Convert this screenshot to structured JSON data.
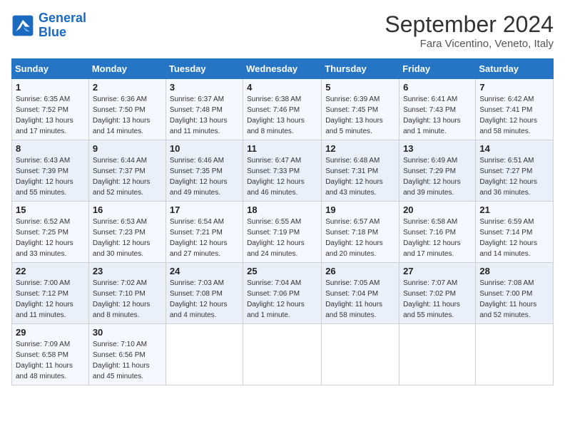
{
  "header": {
    "logo_line1": "General",
    "logo_line2": "Blue",
    "month_title": "September 2024",
    "location": "Fara Vicentino, Veneto, Italy"
  },
  "columns": [
    "Sunday",
    "Monday",
    "Tuesday",
    "Wednesday",
    "Thursday",
    "Friday",
    "Saturday"
  ],
  "weeks": [
    [
      {
        "day": "1",
        "rise": "6:35 AM",
        "set": "7:52 PM",
        "daylight": "13 hours and 17 minutes."
      },
      {
        "day": "2",
        "rise": "6:36 AM",
        "set": "7:50 PM",
        "daylight": "13 hours and 14 minutes."
      },
      {
        "day": "3",
        "rise": "6:37 AM",
        "set": "7:48 PM",
        "daylight": "13 hours and 11 minutes."
      },
      {
        "day": "4",
        "rise": "6:38 AM",
        "set": "7:46 PM",
        "daylight": "13 hours and 8 minutes."
      },
      {
        "day": "5",
        "rise": "6:39 AM",
        "set": "7:45 PM",
        "daylight": "13 hours and 5 minutes."
      },
      {
        "day": "6",
        "rise": "6:41 AM",
        "set": "7:43 PM",
        "daylight": "13 hours and 1 minute."
      },
      {
        "day": "7",
        "rise": "6:42 AM",
        "set": "7:41 PM",
        "daylight": "12 hours and 58 minutes."
      }
    ],
    [
      {
        "day": "8",
        "rise": "6:43 AM",
        "set": "7:39 PM",
        "daylight": "12 hours and 55 minutes."
      },
      {
        "day": "9",
        "rise": "6:44 AM",
        "set": "7:37 PM",
        "daylight": "12 hours and 52 minutes."
      },
      {
        "day": "10",
        "rise": "6:46 AM",
        "set": "7:35 PM",
        "daylight": "12 hours and 49 minutes."
      },
      {
        "day": "11",
        "rise": "6:47 AM",
        "set": "7:33 PM",
        "daylight": "12 hours and 46 minutes."
      },
      {
        "day": "12",
        "rise": "6:48 AM",
        "set": "7:31 PM",
        "daylight": "12 hours and 43 minutes."
      },
      {
        "day": "13",
        "rise": "6:49 AM",
        "set": "7:29 PM",
        "daylight": "12 hours and 39 minutes."
      },
      {
        "day": "14",
        "rise": "6:51 AM",
        "set": "7:27 PM",
        "daylight": "12 hours and 36 minutes."
      }
    ],
    [
      {
        "day": "15",
        "rise": "6:52 AM",
        "set": "7:25 PM",
        "daylight": "12 hours and 33 minutes."
      },
      {
        "day": "16",
        "rise": "6:53 AM",
        "set": "7:23 PM",
        "daylight": "12 hours and 30 minutes."
      },
      {
        "day": "17",
        "rise": "6:54 AM",
        "set": "7:21 PM",
        "daylight": "12 hours and 27 minutes."
      },
      {
        "day": "18",
        "rise": "6:55 AM",
        "set": "7:19 PM",
        "daylight": "12 hours and 24 minutes."
      },
      {
        "day": "19",
        "rise": "6:57 AM",
        "set": "7:18 PM",
        "daylight": "12 hours and 20 minutes."
      },
      {
        "day": "20",
        "rise": "6:58 AM",
        "set": "7:16 PM",
        "daylight": "12 hours and 17 minutes."
      },
      {
        "day": "21",
        "rise": "6:59 AM",
        "set": "7:14 PM",
        "daylight": "12 hours and 14 minutes."
      }
    ],
    [
      {
        "day": "22",
        "rise": "7:00 AM",
        "set": "7:12 PM",
        "daylight": "12 hours and 11 minutes."
      },
      {
        "day": "23",
        "rise": "7:02 AM",
        "set": "7:10 PM",
        "daylight": "12 hours and 8 minutes."
      },
      {
        "day": "24",
        "rise": "7:03 AM",
        "set": "7:08 PM",
        "daylight": "12 hours and 4 minutes."
      },
      {
        "day": "25",
        "rise": "7:04 AM",
        "set": "7:06 PM",
        "daylight": "12 hours and 1 minute."
      },
      {
        "day": "26",
        "rise": "7:05 AM",
        "set": "7:04 PM",
        "daylight": "11 hours and 58 minutes."
      },
      {
        "day": "27",
        "rise": "7:07 AM",
        "set": "7:02 PM",
        "daylight": "11 hours and 55 minutes."
      },
      {
        "day": "28",
        "rise": "7:08 AM",
        "set": "7:00 PM",
        "daylight": "11 hours and 52 minutes."
      }
    ],
    [
      {
        "day": "29",
        "rise": "7:09 AM",
        "set": "6:58 PM",
        "daylight": "11 hours and 48 minutes."
      },
      {
        "day": "30",
        "rise": "7:10 AM",
        "set": "6:56 PM",
        "daylight": "11 hours and 45 minutes."
      },
      null,
      null,
      null,
      null,
      null
    ]
  ]
}
